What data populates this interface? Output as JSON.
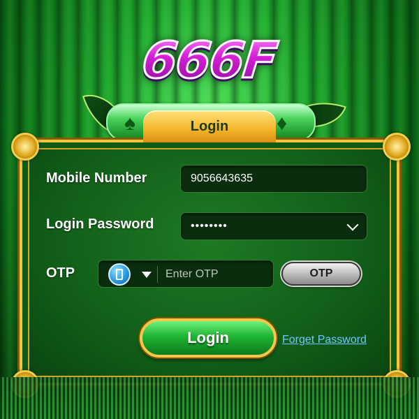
{
  "brand": {
    "logo_text": "666F"
  },
  "tab": {
    "label": "Login"
  },
  "form": {
    "mobile_label": "Mobile Number",
    "mobile_value": "9056643635",
    "password_label": "Login Password",
    "password_value": "••••••••",
    "otp_label": "OTP",
    "otp_placeholder": "Enter OTP",
    "otp_button_label": "OTP"
  },
  "actions": {
    "login_label": "Login",
    "forget_password_label": "Forget Password"
  },
  "icons": {
    "otp_method": "phone-icon",
    "password_dropdown": "chevron-down-icon"
  },
  "colors": {
    "accent_gold": "#f3c53b",
    "panel_green": "#115d18",
    "link_blue": "#6fc7ff",
    "logo_magenta": "#d81fd8"
  }
}
